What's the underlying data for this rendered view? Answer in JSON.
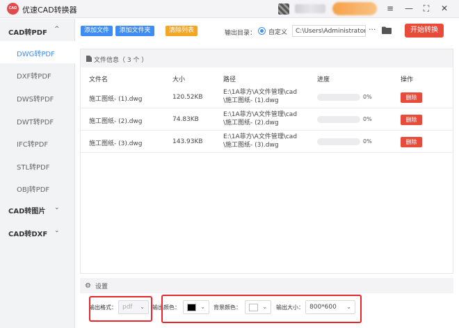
{
  "app": {
    "logo_text": "CAD",
    "title": "优速CAD转换器"
  },
  "window_controls": {
    "menu": "≡",
    "minimize": "—",
    "maximize": "⛶",
    "close": "✕"
  },
  "sidebar": {
    "groups": [
      {
        "label": "CAD转PDF",
        "chevron": "^",
        "expanded": true
      },
      {
        "label": "CAD转图片",
        "chevron": "⌄",
        "expanded": false
      },
      {
        "label": "CAD转DXF",
        "chevron": "⌄",
        "expanded": false
      }
    ],
    "items": [
      {
        "label": "DWG转PDF",
        "active": true
      },
      {
        "label": "DXF转PDF",
        "active": false
      },
      {
        "label": "DWS转PDF",
        "active": false
      },
      {
        "label": "DWT转PDF",
        "active": false
      },
      {
        "label": "IFC转PDF",
        "active": false
      },
      {
        "label": "STL转PDF",
        "active": false
      },
      {
        "label": "OBJ转PDF",
        "active": false
      }
    ]
  },
  "toolbar": {
    "add_file": "添加文件",
    "add_folder": "添加文件夹",
    "clear_list": "清除列表",
    "output_dir_label": "输出目录：",
    "custom_label": "自定义",
    "path_value": "C:\\Users\\Administrator\\",
    "more": "···",
    "start": "开始转换"
  },
  "file_info": {
    "title": "文件信息（ 3 个 ）",
    "columns": [
      "文件名",
      "大小",
      "路径",
      "进度",
      "操作"
    ],
    "rows": [
      {
        "name": "施工图纸- (1).dwg",
        "size": "120.52KB",
        "path1": "E:\\1A菲方\\A文件管理\\cad",
        "path2": "\\施工图纸- (1).dwg",
        "progress": "0%",
        "action": "删除"
      },
      {
        "name": "施工图纸- (2).dwg",
        "size": "74.83KB",
        "path1": "E:\\1A菲方\\A文件管理\\cad",
        "path2": "\\施工图纸- (2).dwg",
        "progress": "0%",
        "action": "删除"
      },
      {
        "name": "施工图纸- (3).dwg",
        "size": "143.93KB",
        "path1": "E:\\1A菲方\\A文件管理\\cad",
        "path2": "\\施工图纸- (3).dwg",
        "progress": "0%",
        "action": "删除"
      }
    ]
  },
  "settings": {
    "title": "设置",
    "format_label": "输出格式：",
    "format_value": "pdf",
    "color_label": "输出颜色：",
    "color_value": "#000000",
    "bg_label": "背景颜色：",
    "bg_value": "#ffffff",
    "size_label": "输出大小：",
    "size_value": "800*600"
  },
  "colors": {
    "accent_blue": "#3d8df5",
    "orange": "#f5a623",
    "danger_red": "#e94b3a",
    "highlight_box": "#e8242c"
  }
}
